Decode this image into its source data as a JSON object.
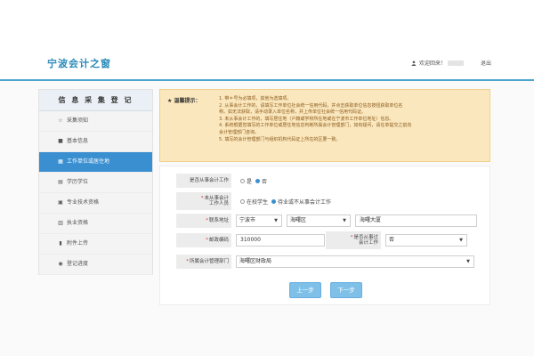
{
  "header": {
    "brand": "宁波会计之窗",
    "welcome": "欢迎回来！",
    "logout": "退出"
  },
  "sidebar": {
    "title": "信 息 采 集 登 记",
    "items": [
      {
        "icon": "☆",
        "label": "采集须知"
      },
      {
        "icon": "■",
        "label": "基本信息"
      },
      {
        "icon": "▦",
        "label": "工作单位或居住地"
      },
      {
        "icon": "▤",
        "label": "学历学位"
      },
      {
        "icon": "▣",
        "label": "专业技术资格"
      },
      {
        "icon": "▥",
        "label": "执业资格"
      },
      {
        "icon": "▮",
        "label": "附件上传"
      },
      {
        "icon": "◉",
        "label": "登记进度"
      }
    ]
  },
  "notice": {
    "label": "★ 温馨提示：",
    "lines": [
      "1. 带＊号为必填项，其他为选填项。",
      "2. 从事会计工作的，请填写工作单位社会统一信用代码，并点击获取单位信息按钮获取单位名",
      "称。如无法获取，请手动录入单位名称，并上传单位社会统一信用代码证。",
      "3. 未从事会计工作的，填写居住地（户籍或学校所在地或在宁波市工作单位地址）信息。",
      "4. 系统根据您填写的工作单位或居住地信息判断所属会计管理部门，如有疑问，请在单提交之前向",
      "会计管理部门咨询。",
      "5. 填写的会计管理部门与组织机构代码证上所在的区要一致。"
    ]
  },
  "form": {
    "engaged": {
      "label": "是否从事会计工作",
      "options": [
        "是",
        "否"
      ],
      "selected": "否"
    },
    "status": {
      "label_1": "未从事会计",
      "label_2": "工作人员",
      "options": [
        "在校学生",
        "待业或不从事会计工作"
      ],
      "selected": "待业或不从事会计工作"
    },
    "address": {
      "label": "联系地址",
      "city": "宁波市",
      "district": "海曙区",
      "street": "海曙大厦"
    },
    "postal": {
      "label": "邮政编码",
      "value": "310000"
    },
    "past": {
      "label_1": "是否从事过",
      "label_2": "会计工作",
      "value": "否"
    },
    "dept": {
      "label": "所属会计管理部门",
      "value": "海曙区财政局"
    }
  },
  "buttons": {
    "prev": "上一步",
    "next": "下一步"
  },
  "colors": {
    "accent": "#3a8fd0",
    "brand": "#2a8ab8",
    "notice_bg": "#fbe7bd"
  }
}
